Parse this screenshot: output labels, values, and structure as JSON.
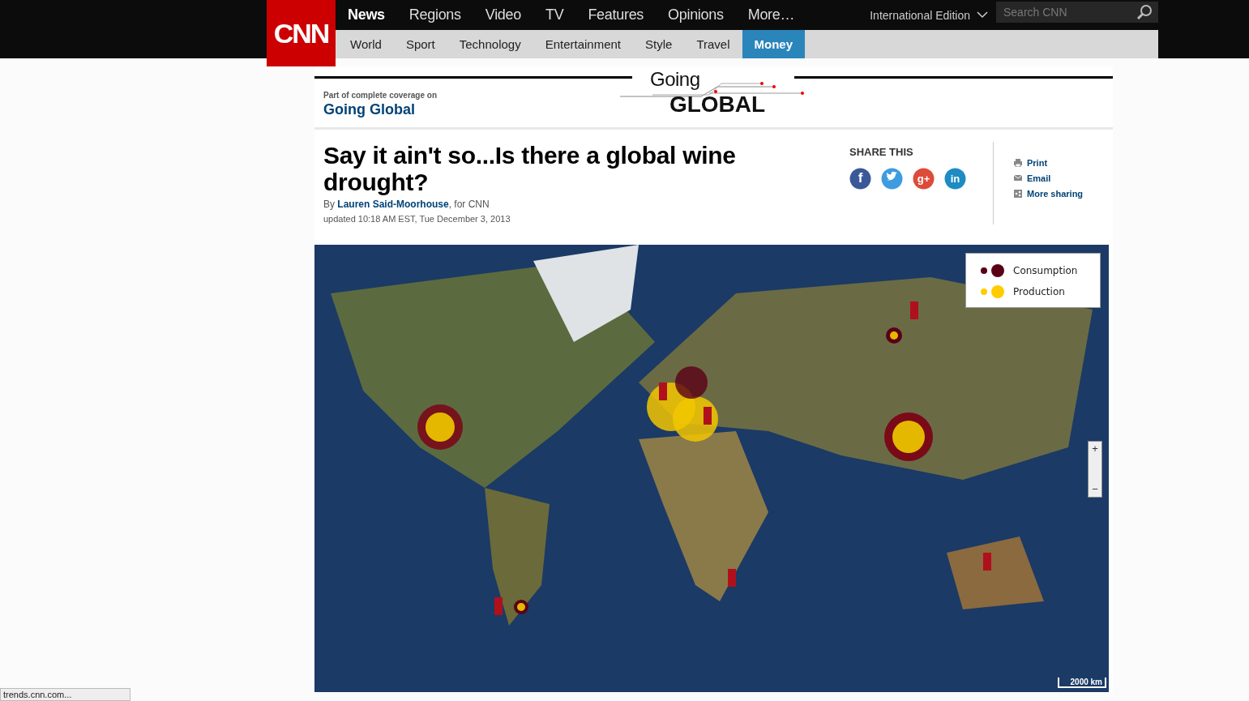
{
  "header": {
    "logo": "CNN",
    "nav": [
      {
        "label": "News",
        "selected": true
      },
      {
        "label": "Regions",
        "selected": false
      },
      {
        "label": "Video",
        "selected": false
      },
      {
        "label": "TV",
        "selected": false
      },
      {
        "label": "Features",
        "selected": false
      },
      {
        "label": "Opinions",
        "selected": false
      },
      {
        "label": "More…",
        "selected": false
      }
    ],
    "edition": "International Edition",
    "search": {
      "placeholder": "Search CNN"
    },
    "subnav": [
      {
        "label": "World",
        "selected": false
      },
      {
        "label": "Sport",
        "selected": false
      },
      {
        "label": "Technology",
        "selected": false
      },
      {
        "label": "Entertainment",
        "selected": false
      },
      {
        "label": "Style",
        "selected": false
      },
      {
        "label": "Travel",
        "selected": false
      },
      {
        "label": "Money",
        "selected": true
      }
    ]
  },
  "coverage": {
    "intro": "Part of complete coverage on",
    "link": "Going Global",
    "banner_top": "Going",
    "banner_bottom": "GLOBAL"
  },
  "article": {
    "headline": "Say it ain't so...Is there a global wine drought?",
    "byline_prefix": "By ",
    "author": "Lauren Said-Moorhouse",
    "byline_suffix": ", for CNN",
    "updated": "updated 10:18 AM EST, Tue December 3, 2013"
  },
  "share": {
    "title": "SHARE THIS",
    "networks": [
      {
        "kind": "facebook",
        "glyph": "f",
        "color": "#3b5998"
      },
      {
        "kind": "twitter",
        "color": "#3d9be0"
      },
      {
        "kind": "googleplus",
        "glyph": "g+",
        "color": "#dd4b39"
      },
      {
        "kind": "linkedin",
        "glyph": "in",
        "color": "#1e8bc3"
      }
    ],
    "links": [
      {
        "kind": "print",
        "label": "Print"
      },
      {
        "kind": "email",
        "label": "Email"
      },
      {
        "kind": "more",
        "label": "More sharing"
      }
    ]
  },
  "map": {
    "legend": [
      {
        "label": "Consumption",
        "color": "#5a0015"
      },
      {
        "label": "Production",
        "color": "#ffcc00"
      }
    ],
    "zoom_in": "+",
    "zoom_out": "−",
    "scale": "2000 km"
  },
  "status_bar": {
    "url": "trends.cnn.com..."
  }
}
